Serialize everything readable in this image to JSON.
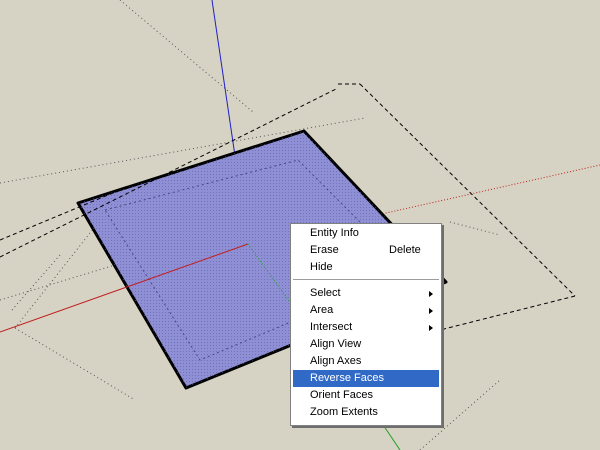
{
  "scene": {
    "background_color": "#d6d3c4",
    "face_color": "#8f8fd6",
    "axis_colors": {
      "red": "#c02020",
      "green": "#20a020",
      "blue": "#2020c8"
    }
  },
  "context_menu": {
    "items": [
      {
        "label": "Entity Info",
        "shortcut": "",
        "submenu": false,
        "highlighted": false
      },
      {
        "label": "Erase",
        "shortcut": "Delete",
        "submenu": false,
        "highlighted": false
      },
      {
        "label": "Hide",
        "shortcut": "",
        "submenu": false,
        "highlighted": false
      },
      {
        "label": "Select",
        "shortcut": "",
        "submenu": true,
        "highlighted": false
      },
      {
        "label": "Area",
        "shortcut": "",
        "submenu": true,
        "highlighted": false
      },
      {
        "label": "Intersect",
        "shortcut": "",
        "submenu": true,
        "highlighted": false
      },
      {
        "label": "Align View",
        "shortcut": "",
        "submenu": false,
        "highlighted": false
      },
      {
        "label": "Align Axes",
        "shortcut": "",
        "submenu": false,
        "highlighted": false
      },
      {
        "label": "Reverse Faces",
        "shortcut": "",
        "submenu": false,
        "highlighted": true
      },
      {
        "label": "Orient Faces",
        "shortcut": "",
        "submenu": false,
        "highlighted": false
      },
      {
        "label": "Zoom Extents",
        "shortcut": "",
        "submenu": false,
        "highlighted": false
      }
    ],
    "highlight_color": "#3169c6"
  }
}
